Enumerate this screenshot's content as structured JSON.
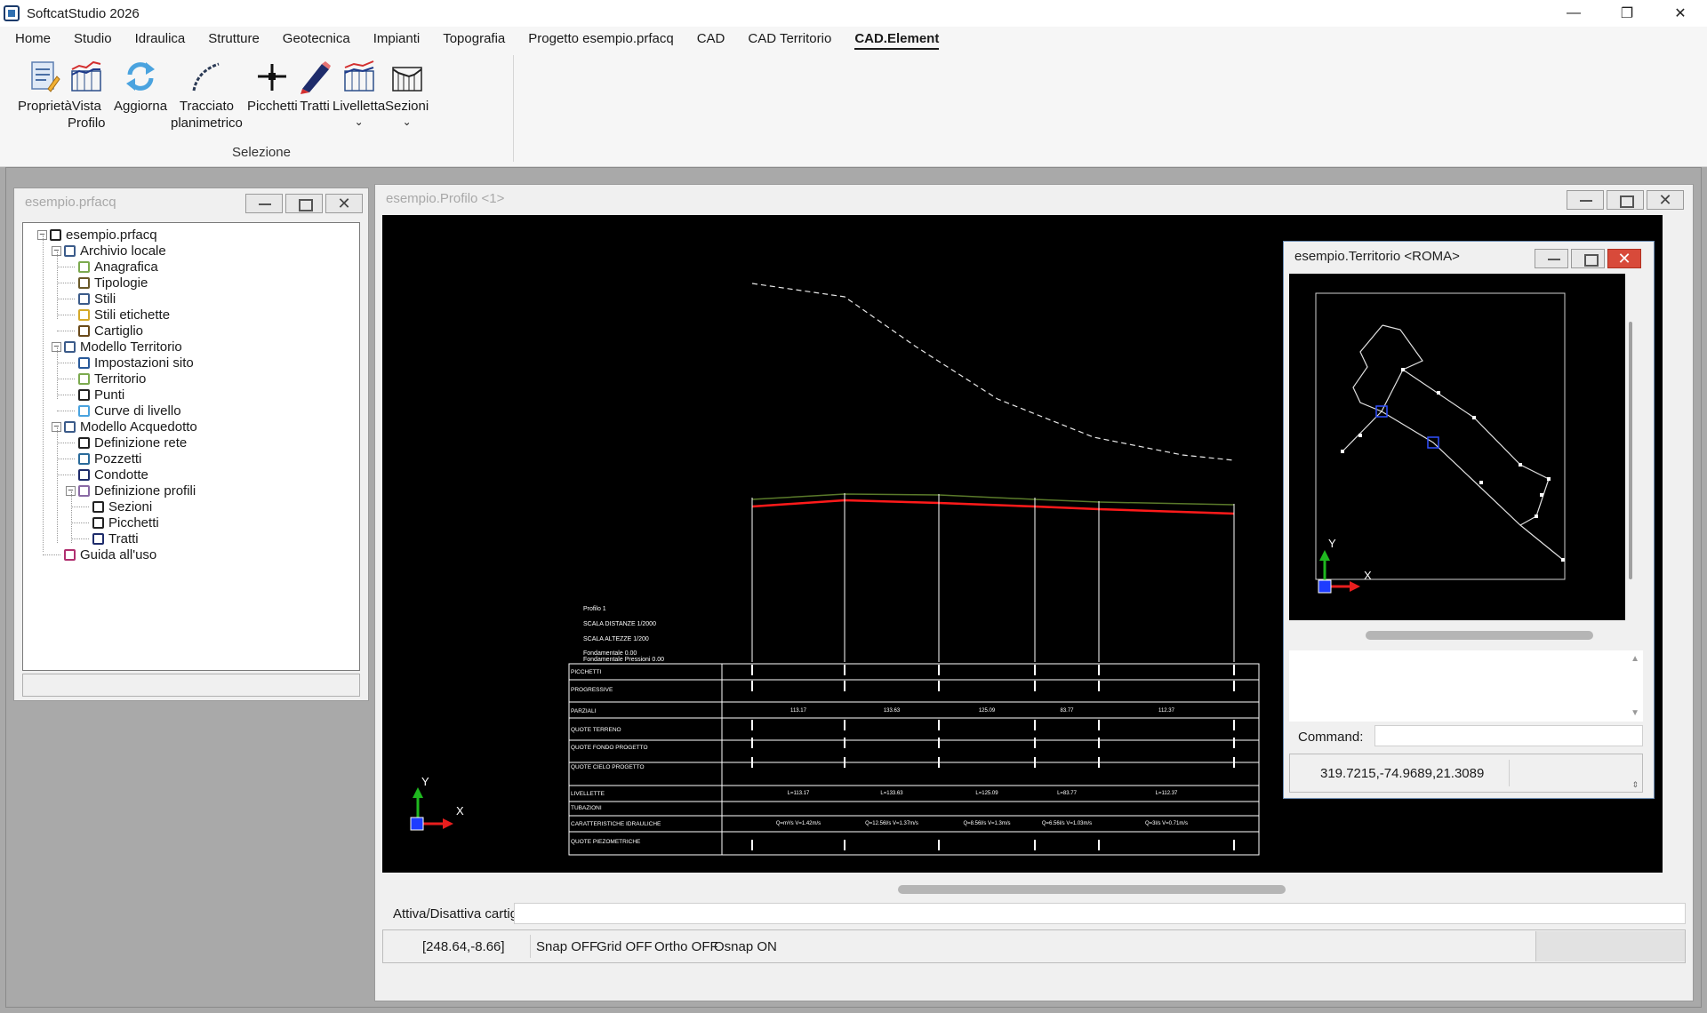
{
  "app": {
    "title": "SoftcatStudio 2026"
  },
  "window_controls": {
    "minimize": "—",
    "maximize": "❐",
    "close": "✕"
  },
  "menu": [
    "Home",
    "Studio",
    "Idraulica",
    "Strutture",
    "Geotecnica",
    "Impianti",
    "Topografia",
    "Progetto esempio.prfacq",
    "CAD",
    "CAD Territorio",
    "CAD.Element"
  ],
  "menu_active": "CAD.Element",
  "ribbon": {
    "buttons": [
      {
        "l1": "Proprietà",
        "l2": "",
        "icon": "properties-icon"
      },
      {
        "l1": "Vista",
        "l2": "Profilo",
        "icon": "profile-chart-icon"
      },
      {
        "l1": "Aggiorna",
        "l2": "",
        "icon": "refresh-icon"
      },
      {
        "l1": "Tracciato",
        "l2": "planimetrico",
        "icon": "alignment-curve-icon"
      },
      {
        "l1": "Picchetti",
        "l2": "",
        "icon": "stake-cross-icon"
      },
      {
        "l1": "Tratti",
        "l2": "",
        "icon": "pencil-segment-icon"
      },
      {
        "l1": "Livelletta",
        "l2": "⌄",
        "icon": "grade-chart-icon"
      },
      {
        "l1": "Sezioni",
        "l2": "⌄",
        "icon": "sections-icon"
      }
    ],
    "group_label": "Selezione"
  },
  "project_window": {
    "title": "esempio.prfacq",
    "tree": [
      {
        "label": "esempio.prfacq",
        "level": 0,
        "icon": "network-icon",
        "expanded": true
      },
      {
        "label": "Archivio locale",
        "level": 1,
        "icon": "archive-icon",
        "expanded": true
      },
      {
        "label": "Anagrafica",
        "level": 2,
        "icon": "people-icon"
      },
      {
        "label": "Tipologie",
        "level": 2,
        "icon": "tools-icon"
      },
      {
        "label": "Stili",
        "level": 2,
        "icon": "styles-icon"
      },
      {
        "label": "Stili etichette",
        "level": 2,
        "icon": "label-styles-icon"
      },
      {
        "label": "Cartiglio",
        "level": 2,
        "icon": "title-block-icon"
      },
      {
        "label": "Modello Territorio",
        "level": 1,
        "icon": "terrain-model-icon",
        "expanded": true
      },
      {
        "label": "Impostazioni sito",
        "level": 2,
        "icon": "globe-icon"
      },
      {
        "label": "Territorio",
        "level": 2,
        "icon": "territory-icon"
      },
      {
        "label": "Punti",
        "level": 2,
        "icon": "points-icon"
      },
      {
        "label": "Curve di livello",
        "level": 2,
        "icon": "contour-icon"
      },
      {
        "label": "Modello Acquedotto",
        "level": 1,
        "icon": "aqueduct-icon",
        "expanded": true
      },
      {
        "label": "Definizione rete",
        "level": 2,
        "icon": "network-icon"
      },
      {
        "label": "Pozzetti",
        "level": 2,
        "icon": "manhole-icon"
      },
      {
        "label": "Condotte",
        "level": 2,
        "icon": "pipe-icon"
      },
      {
        "label": "Definizione profili",
        "level": 2,
        "icon": "profiles-icon",
        "expanded": true
      },
      {
        "label": "Sezioni",
        "level": 3,
        "icon": "sections-icon"
      },
      {
        "label": "Picchetti",
        "level": 3,
        "icon": "stake-cross-icon"
      },
      {
        "label": "Tratti",
        "level": 3,
        "icon": "pencil-segment-icon"
      },
      {
        "label": "Guida all'uso",
        "level": 1,
        "icon": "book-icon"
      }
    ]
  },
  "profile_window": {
    "title": "esempio.Profilo <1>",
    "info_lines": [
      "Profilo 1",
      "SCALA DISTANZE 1/2000",
      "SCALA ALTEZZE 1/200",
      "Fondamentale 0.00",
      "Fondamentale Pressioni 0.00"
    ],
    "table_rows": [
      "PICCHETTI",
      "PROGRESSIVE",
      "PARZIALI",
      "QUOTE TERRENO",
      "QUOTE FONDO PROGETTO",
      "QUOTE CIELO PROGETTO",
      "LIVELLETTE",
      "TUBAZIONI",
      "CARATTERISTICHE IDRAULICHE",
      "QUOTE PIEZOMETRICHE"
    ],
    "parziali": [
      "113.17",
      "133.63",
      "125.09",
      "83.77",
      "112.37"
    ],
    "livellette": [
      "L=113.17",
      "L=133.63",
      "L=125.09",
      "L=83.77",
      "L=112.37"
    ],
    "caratteristiche": [
      "Q=m³/s V=1.42m/s",
      "Q=12.56l/s V=1.37m/s",
      "Q=8.56l/s V=1.3m/s",
      "Q=6.56l/s V=1.03m/s",
      "Q=3l/s V=0.71m/s"
    ],
    "axis": {
      "x": "X",
      "y": "Y"
    },
    "command_label": "Attiva/Disattiva cartiglio",
    "coords": "[248.64,-8.66]",
    "toggles": [
      "Snap OFF",
      "Grid OFF",
      "Ortho OFF",
      "Osnap ON"
    ]
  },
  "territory_window": {
    "title": "esempio.Territorio <ROMA>",
    "command_label": "Command:",
    "coords": "319.7215,-74.9689,21.3089",
    "axis": {
      "x": "X",
      "y": "Y"
    }
  }
}
